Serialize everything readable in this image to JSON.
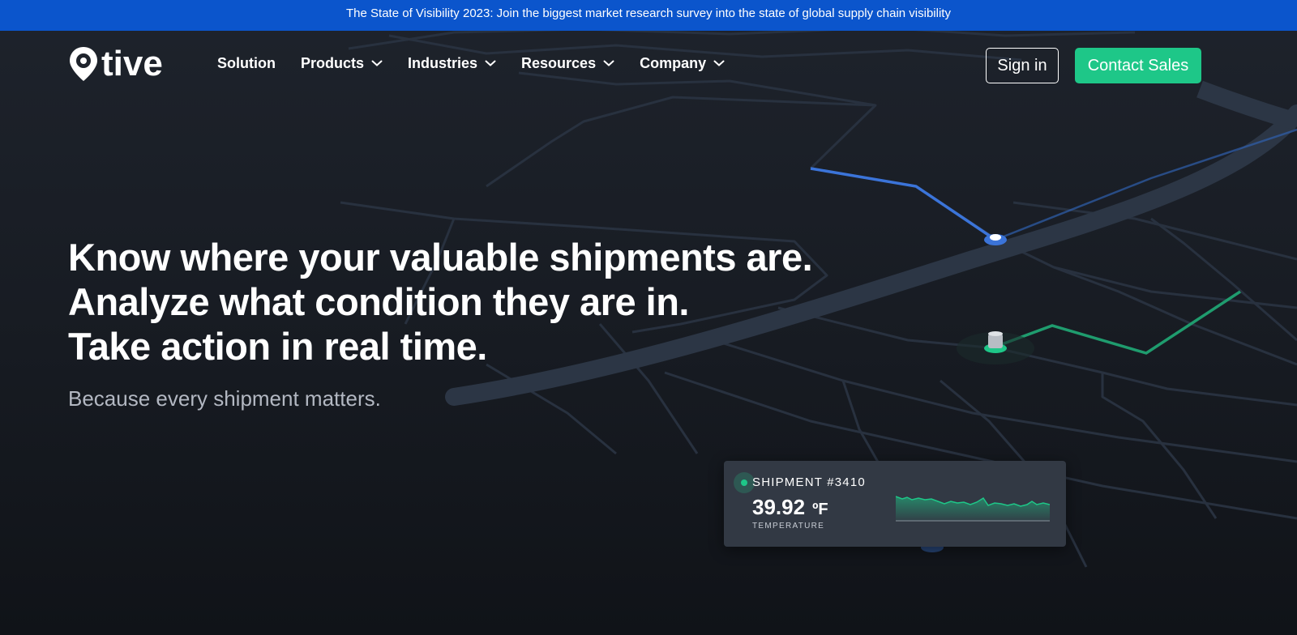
{
  "banner": {
    "text": "The State of Visibility 2023: Join the biggest market research survey into the state of global supply chain visibility"
  },
  "header": {
    "logo_text": "tive",
    "logo_icon": "location-pin-icon",
    "nav": [
      {
        "label": "Solution",
        "has_dropdown": false
      },
      {
        "label": "Products",
        "has_dropdown": true
      },
      {
        "label": "Industries",
        "has_dropdown": true
      },
      {
        "label": "Resources",
        "has_dropdown": true
      },
      {
        "label": "Company",
        "has_dropdown": true
      }
    ],
    "sign_in_label": "Sign in",
    "contact_label": "Contact Sales"
  },
  "hero": {
    "lines": [
      "Know where your valuable shipments are.",
      "Analyze what condition they are in.",
      "Take action in real time."
    ],
    "subtitle": "Because every shipment matters."
  },
  "shipment_card": {
    "title": "SHIPMENT #3410",
    "value": "39.92",
    "unit": "ºF",
    "label": "TEMPERATURE"
  },
  "colors": {
    "banner": "#0b55cc",
    "accent_green": "#1ec788",
    "route_blue": "#3b74d9",
    "background": "#1a1e26"
  }
}
